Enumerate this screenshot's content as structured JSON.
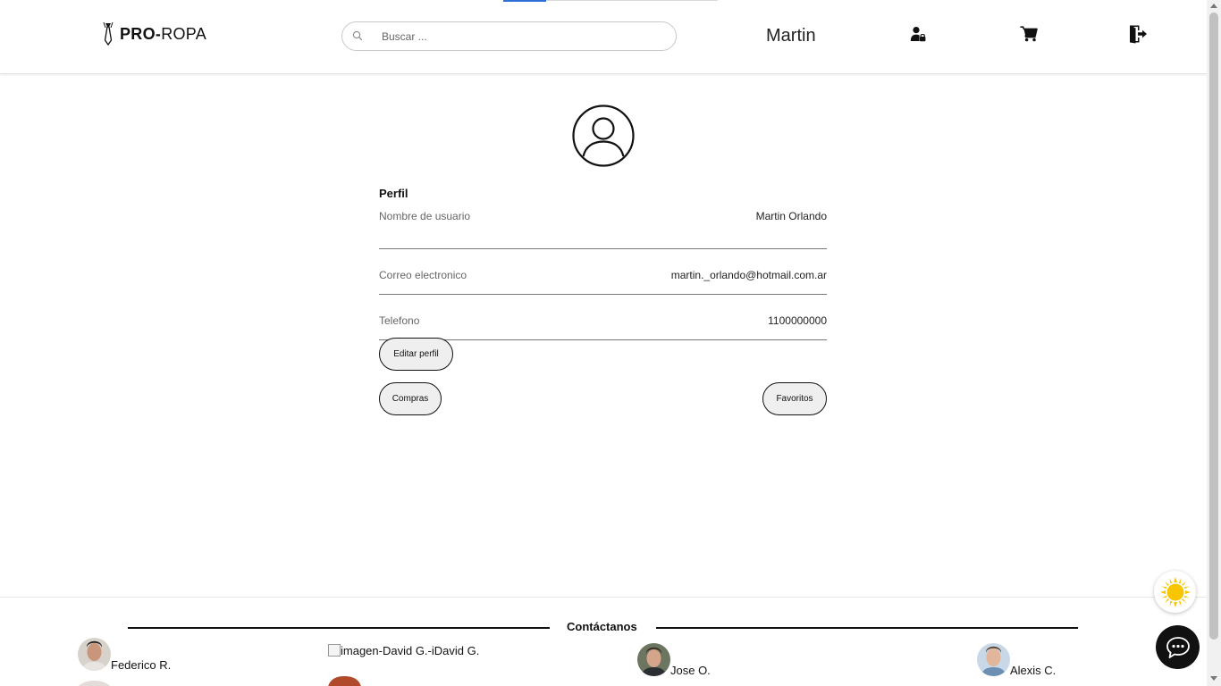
{
  "header": {
    "logo_bold": "PRO-",
    "logo_light": "ROPA",
    "search_placeholder": "Buscar ...",
    "username": "Martin",
    "icons": [
      "user-lock-icon",
      "cart-icon",
      "logout-icon"
    ]
  },
  "profile": {
    "title": "Perfil",
    "fields": [
      {
        "label": "Nombre de usuario",
        "value": "Martin Orlando"
      },
      {
        "label": "Correo electronico",
        "value": "martin._orlando@hotmail.com.ar"
      },
      {
        "label": "Telefono",
        "value": "1100000000"
      }
    ],
    "edit_button": "Editar perfil",
    "purchases_button": "Compras",
    "favorites_button": "Favoritos"
  },
  "footer": {
    "title": "Contáctanos",
    "contacts": [
      {
        "name": "Federico R."
      },
      {
        "name": "imagen-David G.-iDavid G."
      },
      {
        "name": "Jose O."
      },
      {
        "name": "Alexis C."
      }
    ]
  },
  "colors": {
    "accent": "#2f6fd6",
    "button_bg": "#efefef",
    "sun": "#f7c600"
  }
}
